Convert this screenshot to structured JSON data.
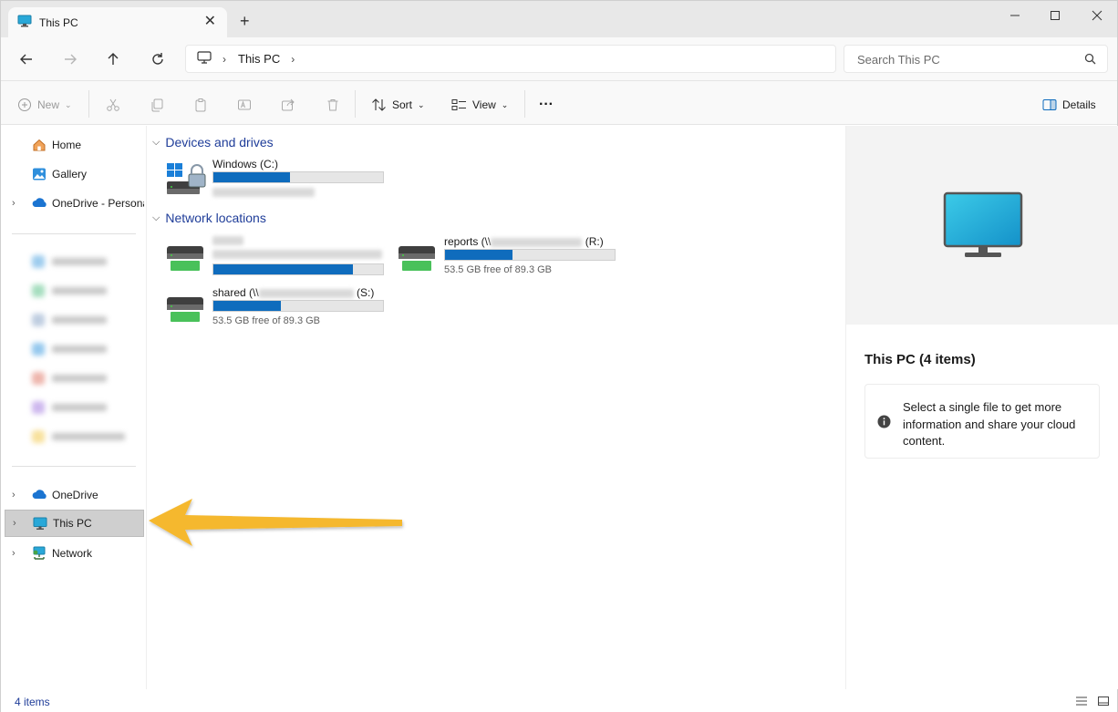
{
  "window": {
    "tab_title": "This PC",
    "new_tab_label": "+",
    "close_tab_label": "✕"
  },
  "address_bar": {
    "location": "This PC",
    "search_placeholder": "Search This PC"
  },
  "toolbar": {
    "new_label": "New",
    "sort_label": "Sort",
    "view_label": "View",
    "more_label": "···",
    "details_label": "Details"
  },
  "sidebar": {
    "home": "Home",
    "gallery": "Gallery",
    "onedrive_personal": "OneDrive - Persona",
    "onedrive": "OneDrive",
    "this_pc": "This PC",
    "network": "Network"
  },
  "content": {
    "devices_header": "Devices and drives",
    "network_header": "Network locations",
    "drives": [
      {
        "name": "Windows (C:)",
        "used_fraction": 0.45
      },
      {
        "name": "",
        "used_fraction": 0.82
      },
      {
        "name_prefix": "reports (\\\\",
        "name_suffix": " (R:)",
        "free_text": "53.5 GB free of 89.3 GB",
        "used_fraction": 0.4
      },
      {
        "name_prefix": "shared (\\\\",
        "name_suffix": " (S:)",
        "free_text": "53.5 GB free of 89.3 GB",
        "used_fraction": 0.4
      }
    ]
  },
  "details_pane": {
    "title": "This PC (4 items)",
    "message": "Select a single file to get more information and share your cloud content."
  },
  "status": {
    "item_count": "4 items"
  },
  "colors": {
    "accent": "#0f6cbd",
    "header_text": "#1f3d99",
    "arrow": "#f5b82e"
  }
}
